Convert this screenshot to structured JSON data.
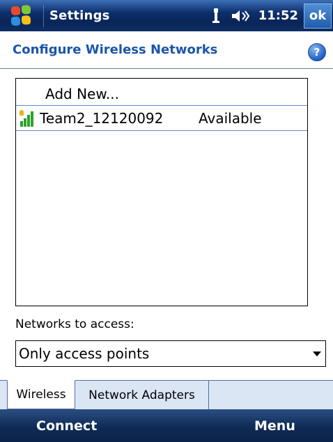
{
  "titlebar": {
    "title": "Settings",
    "time": "11:52",
    "ok_label": "ok"
  },
  "header": {
    "page_title": "Configure Wireless Networks",
    "help_label": "?"
  },
  "network_list": {
    "add_new_label": "Add New...",
    "networks": [
      {
        "name": "Team2_12120092",
        "status": "Available"
      }
    ]
  },
  "access": {
    "label": "Networks to access:",
    "selected": "Only access points"
  },
  "tabs": [
    {
      "label": "Wireless",
      "active": true
    },
    {
      "label": "Network Adapters",
      "active": false
    }
  ],
  "softkeys": {
    "left": "Connect",
    "right": "Menu"
  },
  "colors": {
    "title_blue": "#1b55a8",
    "bar_dark": "#0d2f6b",
    "signal_green": "#2ca12c",
    "selection_line": "#5a8ccc"
  }
}
